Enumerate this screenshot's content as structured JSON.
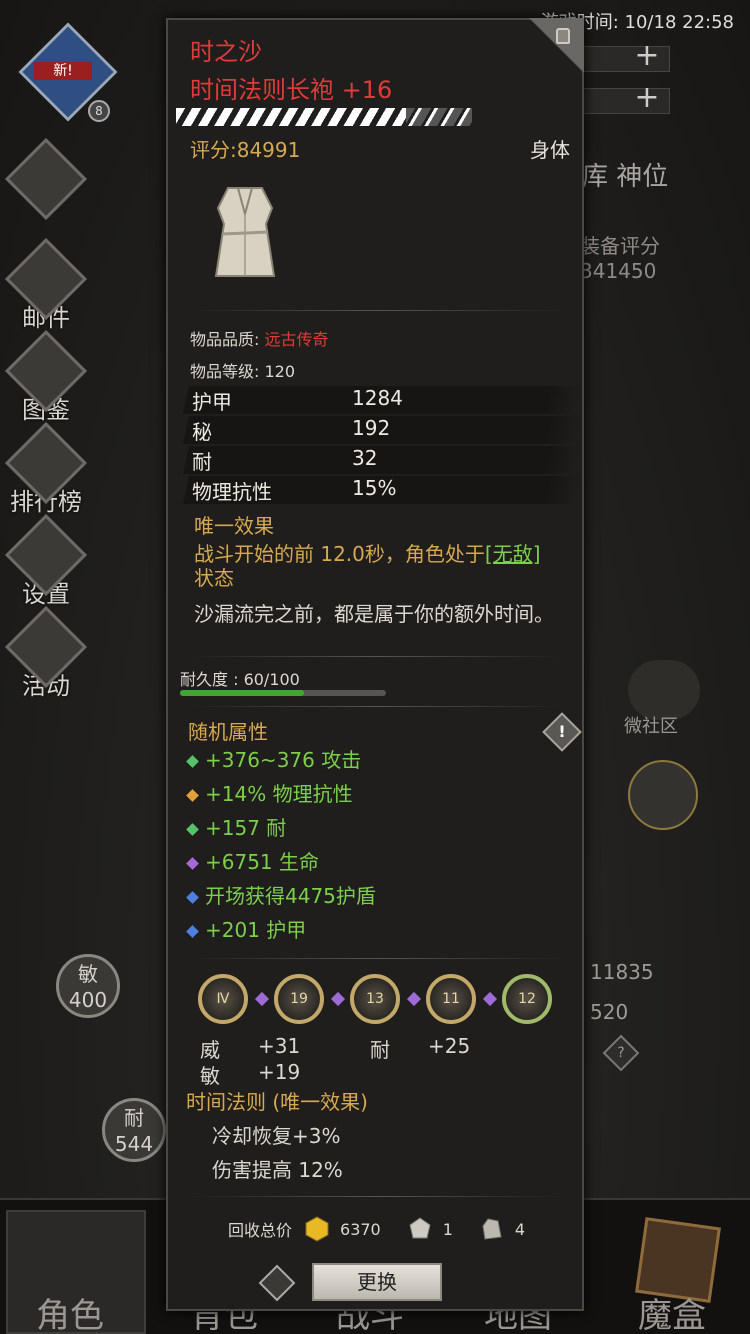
{
  "background": {
    "game_time": "游戏时间: 10/18 22:58",
    "avatar_new_badge": "新!",
    "avatar_level": "8",
    "side_menu": [
      "邮件",
      "图鉴",
      "排行榜",
      "设置",
      "活动"
    ],
    "right_tabs": "库  神位",
    "equip_score_label": "装备评分",
    "equip_score_value": "341450",
    "community_label": "微社区",
    "agility_label": "敏",
    "agility_value": "400",
    "stamina_label": "耐",
    "stamina_value": "544",
    "right_stat_1": "11835",
    "right_stat_2": "520",
    "help_icon_text": "?",
    "bottom_tabs": [
      "角色",
      "背包",
      "战斗",
      "地图",
      "魔盒"
    ]
  },
  "item": {
    "name": "时之沙",
    "subtitle": "时间法则长袍 +16",
    "enhance_level": 16,
    "score": "评分:84991",
    "slot": "身体",
    "quality_label": "物品品质: ",
    "quality_value": "远古传奇",
    "item_level": "物品等级: 120",
    "stats": [
      {
        "k": "护甲",
        "v": "1284"
      },
      {
        "k": "秘",
        "v": "192"
      },
      {
        "k": "耐",
        "v": "32"
      },
      {
        "k": "物理抗性",
        "v": "15%"
      }
    ],
    "unique_title": "唯一效果",
    "unique_desc_a": "战斗开始的前 12.0秒，角色处于",
    "unique_desc_kw": "[无敌]",
    "unique_desc_b": "状态",
    "flavor": "沙漏流完之前，都是属于你的额外时间。",
    "durability": "耐久度 : 60/100",
    "durability_fraction": 0.6,
    "random_title": "随机属性",
    "info_icon_text": "!",
    "random_attrs": [
      {
        "text": "+376~376 攻击",
        "color": "#57c26a"
      },
      {
        "text": "+14% 物理抗性",
        "color": "#e2a13c"
      },
      {
        "text": "+157 耐",
        "color": "#57c26a"
      },
      {
        "text": "+6751 生命",
        "color": "#a768d8"
      },
      {
        "text": "开场获得4475护盾",
        "color": "#4f7fe0"
      },
      {
        "text": "+201 护甲",
        "color": "#4f7fe0"
      }
    ],
    "sockets": [
      "Ⅳ",
      "19",
      "13",
      "11",
      "12"
    ],
    "socket_bonus": [
      {
        "k": "威",
        "v": "+31"
      },
      {
        "k": "耐",
        "v": "+25"
      },
      {
        "k": "敏",
        "v": "+19"
      }
    ],
    "set_title": "时间法则 (唯一效果)",
    "set_effects": [
      "冷却恢复+3%",
      "伤害提高 12%"
    ],
    "recycle_label": "回收总价",
    "recycle_values": [
      "6370",
      "1",
      "4"
    ],
    "replace_button": "更换"
  }
}
